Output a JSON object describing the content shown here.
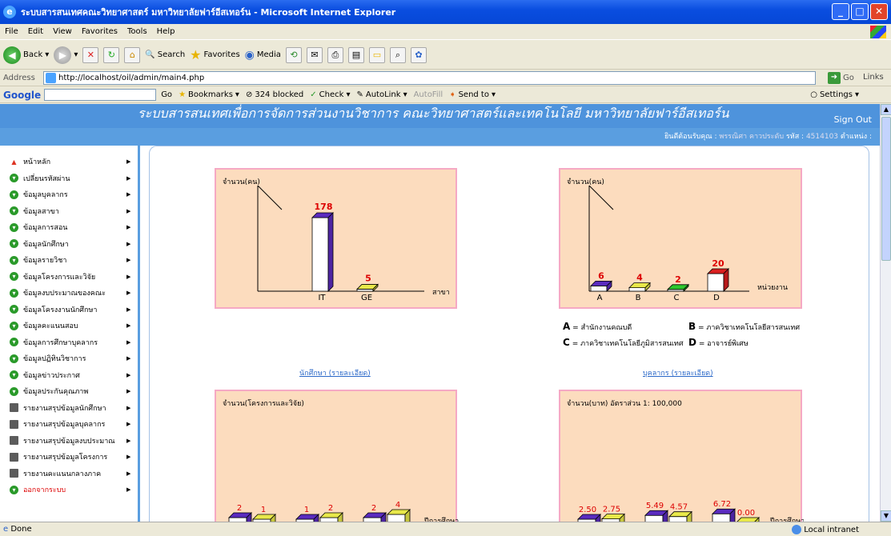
{
  "window": {
    "title": "ระบบสารสนเทศคณะวิทยาศาสตร์ มหาวิทยาลัยฟาร์อีสเทอร์น - Microsoft Internet Explorer"
  },
  "menu": [
    "File",
    "Edit",
    "View",
    "Favorites",
    "Tools",
    "Help"
  ],
  "toolbar": {
    "back": "Back",
    "search": "Search",
    "favorites": "Favorites",
    "media": "Media"
  },
  "address": {
    "label": "Address",
    "url": "http://localhost/oil/admin/main4.php",
    "go": "Go",
    "links": "Links"
  },
  "googlebar": {
    "logo": "Google",
    "go": "Go",
    "bookmarks": "Bookmarks",
    "blocked": "324 blocked",
    "check": "Check",
    "autolink": "AutoLink",
    "autofill": "AutoFill",
    "sendto": "Send to",
    "settings": "Settings"
  },
  "banner": {
    "title": "ระบบสารสนเทศเพื่อการจัดการส่วนงานวิชาการ คณะวิทยาศาสตร์และเทคโนโลยี มหาวิทยาลัยฟาร์อีสเทอร์น",
    "signout": "Sign Out"
  },
  "welcome": {
    "text": "ยินดีต้อนรับคุณ :",
    "name": "พรรณิศา คาวประดับ",
    "code_label": "รหัส :",
    "code": "4514103",
    "position": "ตำแหน่ง :"
  },
  "sidebar": [
    {
      "label": "หน้าหลัก",
      "icon": "home-icon"
    },
    {
      "label": "เปลี่ยนรหัสผ่าน",
      "icon": "arrow-icon"
    },
    {
      "label": "ข้อมูลบุคลากร",
      "icon": "arrow-icon"
    },
    {
      "label": "ข้อมูลสาขา",
      "icon": "arrow-icon"
    },
    {
      "label": "ข้อมูลการสอน",
      "icon": "arrow-icon"
    },
    {
      "label": "ข้อมูลนักศึกษา",
      "icon": "arrow-icon"
    },
    {
      "label": "ข้อมูลรายวิชา",
      "icon": "arrow-icon"
    },
    {
      "label": "ข้อมูลโครงการและวิจัย",
      "icon": "arrow-icon"
    },
    {
      "label": "ข้อมูลงบประมาณของคณะ",
      "icon": "arrow-icon"
    },
    {
      "label": "ข้อมูลโครงงานนักศึกษา",
      "icon": "arrow-icon"
    },
    {
      "label": "ข้อมูลคะแนนสอบ",
      "icon": "arrow-icon"
    },
    {
      "label": "ข้อมูลการศึกษาบุคลากร",
      "icon": "arrow-icon"
    },
    {
      "label": "ข้อมูลปฏิทินวิชาการ",
      "icon": "arrow-icon"
    },
    {
      "label": "ข้อมูลข่าวประกาศ",
      "icon": "arrow-icon"
    },
    {
      "label": "ข้อมูลประกันคุณภาพ",
      "icon": "arrow-icon"
    },
    {
      "label": "รายงานสรุปข้อมูลนักศึกษา",
      "icon": "book-icon"
    },
    {
      "label": "รายงานสรุปข้อมูลบุคลากร",
      "icon": "book-icon"
    },
    {
      "label": "รายงานสรุปข้อมูลงบประมาณ",
      "icon": "book-icon"
    },
    {
      "label": "รายงานสรุปข้อมูลโครงการ",
      "icon": "book-icon"
    },
    {
      "label": "รายงานคะแนนกลางภาค",
      "icon": "book-icon"
    },
    {
      "label": "ออกจากระบบ",
      "icon": "arrow-icon"
    }
  ],
  "chart_data": [
    {
      "type": "bar",
      "ylabel": "จำนวน(คน)",
      "xlabel": "สาขา",
      "categories": [
        "IT",
        "GE"
      ],
      "values": [
        178,
        5
      ],
      "colors": [
        "#5a2bbf",
        "#e8e84a"
      ]
    },
    {
      "type": "bar",
      "ylabel": "จำนวน(คน)",
      "xlabel": "หน่วยงาน",
      "categories": [
        "A",
        "B",
        "C",
        "D"
      ],
      "values": [
        6,
        4,
        2,
        20
      ],
      "colors": [
        "#5a2bbf",
        "#e8e84a",
        "#2ec72e",
        "#d91f1f"
      ]
    },
    {
      "type": "bar",
      "ylabel": "จำนวน(โครงการและวิจัย)",
      "xlabel": "ปีการศึกษา",
      "values": [
        2,
        1,
        1,
        2,
        2,
        4
      ]
    },
    {
      "type": "bar",
      "ylabel": "จำนวน(บาท) อัตราส่วน 1: 100,000",
      "xlabel": "ปีการศึกษา",
      "values": [
        2.5,
        2.75,
        5.49,
        4.57,
        6.72,
        0.0
      ]
    }
  ],
  "legend": {
    "a": "A",
    "a_text": "= สำนักงานคณบดี",
    "b": "B",
    "b_text": "= ภาควิชาเทคโนโลยีสารสนเทศ",
    "c": "C",
    "c_text": "= ภาควิชาเทคโนโลยีภูมิสารสนเทศ",
    "d": "D",
    "d_text": "= อาจารย์พิเศษ"
  },
  "links": {
    "students": "นักศึกษา (รายละเอียด)",
    "staff": "บุคลากร (รายละเอียด)"
  },
  "status": {
    "done": "Done",
    "zone": "Local intranet"
  }
}
